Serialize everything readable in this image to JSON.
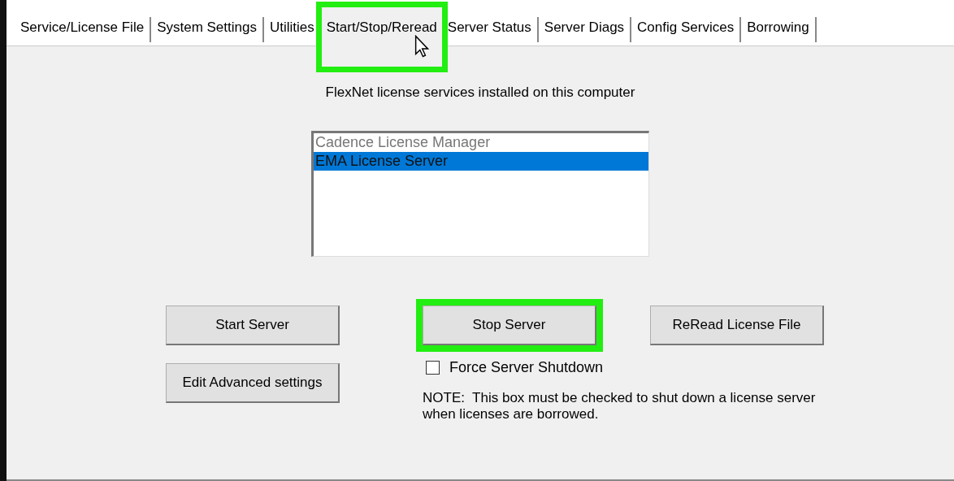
{
  "tabs": [
    {
      "label": "Service/License File",
      "selected": false,
      "highlighted": false
    },
    {
      "label": "System Settings",
      "selected": false,
      "highlighted": false
    },
    {
      "label": "Utilities",
      "selected": false,
      "highlighted": false
    },
    {
      "label": "Start/Stop/Reread",
      "selected": true,
      "highlighted": true
    },
    {
      "label": "Server Status",
      "selected": false,
      "highlighted": false
    },
    {
      "label": "Server Diags",
      "selected": false,
      "highlighted": false
    },
    {
      "label": "Config Services",
      "selected": false,
      "highlighted": false
    },
    {
      "label": "Borrowing",
      "selected": false,
      "highlighted": false
    }
  ],
  "services_label": "FlexNet license services installed on this computer",
  "services": [
    {
      "label": "Cadence License Manager",
      "selected": false
    },
    {
      "label": "EMA License Server",
      "selected": true
    }
  ],
  "buttons": [
    {
      "label": "Start Server",
      "highlighted": false
    },
    {
      "label": "Stop Server",
      "highlighted": true
    },
    {
      "label": "ReRead License File",
      "highlighted": false
    },
    {
      "label": "Edit Advanced settings",
      "highlighted": false
    }
  ],
  "force_shutdown": {
    "label": "Force Server Shutdown",
    "checked": false
  },
  "note": "NOTE:  This box must be checked to shut down a license server when licenses are borrowed."
}
